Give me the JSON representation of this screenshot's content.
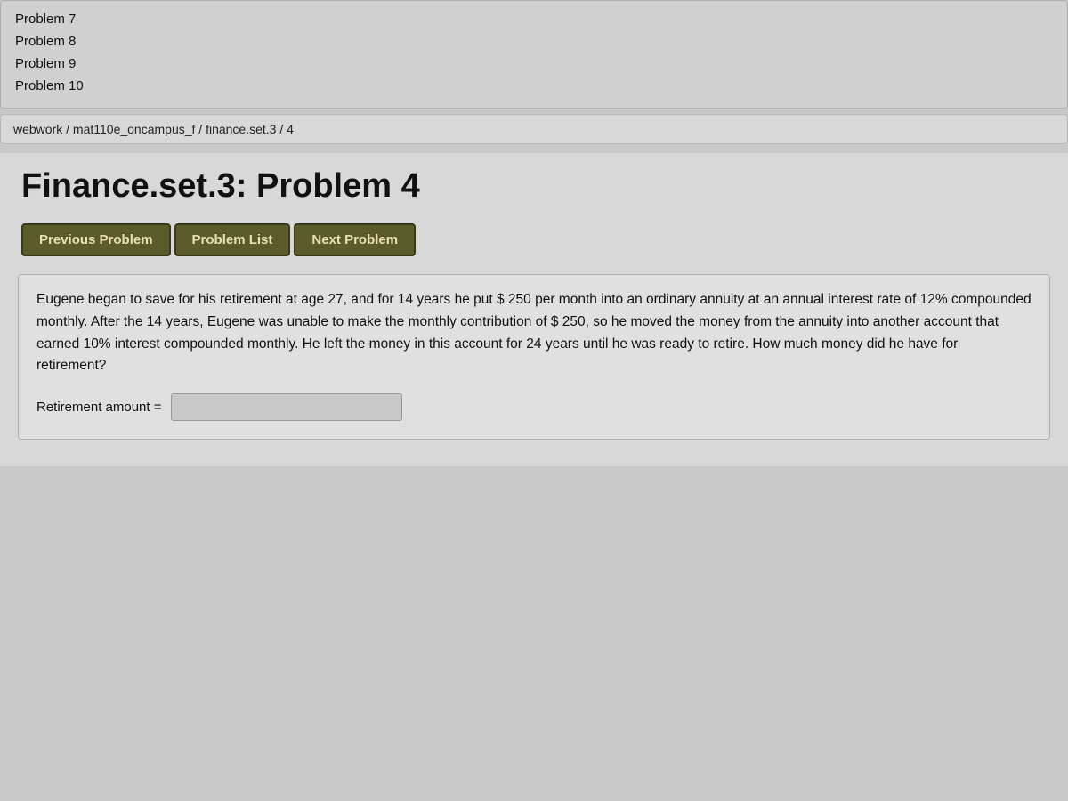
{
  "sidebar": {
    "items": [
      {
        "label": "Problem 7"
      },
      {
        "label": "Problem 8"
      },
      {
        "label": "Problem 9"
      },
      {
        "label": "Problem 10"
      }
    ]
  },
  "breadcrumb": {
    "text": "webwork / mat110e_oncampus_f / finance.set.3 / 4"
  },
  "page": {
    "title": "Finance.set.3: Problem 4"
  },
  "buttons": {
    "previous": "Previous Problem",
    "list": "Problem List",
    "next": "Next Problem"
  },
  "problem": {
    "text": "Eugene began to save for his retirement at age 27, and for 14 years he put $ 250 per month into an ordinary annuity at an annual interest rate of 12% compounded monthly. After the 14 years, Eugene was unable to make the monthly contribution of $ 250, so he moved the money from the annuity into another account that earned 10% interest compounded monthly. He left the money in this account for 24 years until he was ready to retire. How much money did he have for retirement?",
    "answer_label": "Retirement amount =",
    "answer_placeholder": ""
  }
}
